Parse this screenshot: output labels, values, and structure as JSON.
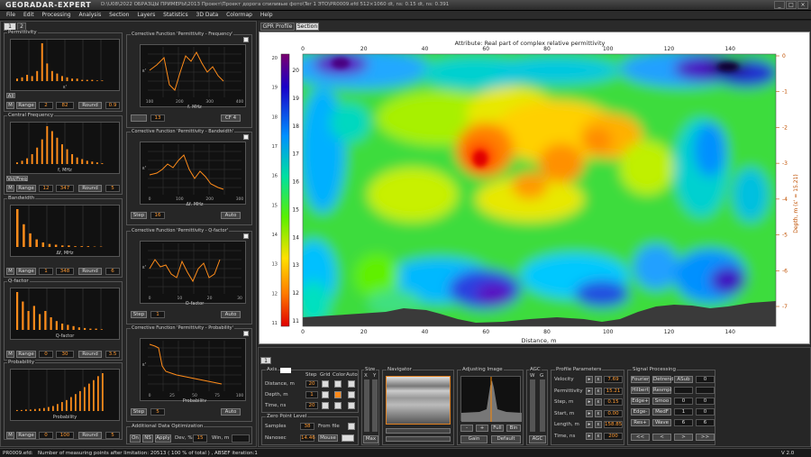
{
  "titlebar": {
    "logo": "GEORADAR-EXPERT",
    "info": "D:\\U08\\2022 ОБРАЗЦЫ ПРИМЕРЫ\\2013 Проект\\Проект дорога спиливые фото\\Ter 1 ЭТО\\PR0009.efd   512×1060   dt, ns: 0.15   dt, ns: 0.391"
  },
  "menu": [
    "File",
    "Edit",
    "Processing",
    "Analysis",
    "Section",
    "Layers",
    "Statistics",
    "3D Data",
    "Colormap",
    "Help"
  ],
  "left_tabs": [
    "1",
    "2"
  ],
  "histograms": [
    {
      "title": "Permittivity",
      "xlabel": "ε'",
      "mode": "M",
      "range_label": "Range",
      "v1": "2",
      "v2": "82",
      "round_label": "Round",
      "v3": "0.9",
      "all_label": "All"
    },
    {
      "title": "Central Frequency",
      "xlabel": "f, MHz",
      "mode": "M",
      "range_label": "Range",
      "v1": "12",
      "v2": "347",
      "round_label": "Round",
      "v3": "5",
      "extra": "Vol/Freq"
    },
    {
      "title": "Bandwidth",
      "xlabel": "Δf, MHz",
      "mode": "M",
      "range_label": "Range",
      "v1": "1",
      "v2": "348",
      "round_label": "Round",
      "v3": "6"
    },
    {
      "title": "Q-factor",
      "xlabel": "Q-factor",
      "mode": "M",
      "range_label": "Range",
      "v1": "0",
      "v2": "30",
      "round_label": "Round",
      "v3": "3.5"
    },
    {
      "title": "Probability",
      "xlabel": "Probability",
      "mode": "M",
      "range_label": "Range",
      "v1": "0",
      "v2": "100",
      "round_label": "Round",
      "v3": "5"
    }
  ],
  "corrective": [
    {
      "title": "Corrective Function 'Permittivity - Frequency'",
      "xlabel": "f, MHz",
      "ylabel": "ε'",
      "b1": "13",
      "b2": "CF 4",
      "xticks": [
        "100",
        "200",
        "300",
        "400"
      ]
    },
    {
      "title": "Corrective Function 'Permittivity - Bandwidth'",
      "xlabel": "Δf, MHz",
      "ylabel": "ε'",
      "b0": "Step",
      "b1": "16",
      "b2": "Auto",
      "xticks": [
        "0",
        "100",
        "200",
        "300"
      ]
    },
    {
      "title": "Corrective Function 'Permittivity - Q-factor'",
      "xlabel": "Q-factor",
      "ylabel": "ε'",
      "b0": "Step",
      "b1": "1",
      "b2": "Auto",
      "xticks": [
        "0",
        "10",
        "20",
        "30"
      ]
    },
    {
      "title": "Corrective Function 'Permittivity - Probability'",
      "xlabel": "Probability",
      "ylabel": "ε'",
      "b0": "Step",
      "b1": "5",
      "b2": "Auto",
      "xticks": [
        "0",
        "25",
        "50",
        "75",
        "100"
      ]
    }
  ],
  "additional": {
    "title": "Additional Data Optimization",
    "on": "On",
    "ns": "NS",
    "apply": "Apply",
    "dev_label": "Dev, %",
    "dev": "15",
    "win_label": "Win, m"
  },
  "main_tabs": [
    "GPR Profile",
    "Section"
  ],
  "chart_data": {
    "type": "heatmap",
    "title": "Attribute:  Real part of complex relative permittivity",
    "xlabel": "Distance, m",
    "ylabel": "Depth, m  (ε' = 15.21)",
    "x_ticks": [
      "0",
      "20",
      "40",
      "60",
      "80",
      "100",
      "120",
      "140"
    ],
    "y_ticks_left": [
      "20",
      "19",
      "18",
      "17",
      "16",
      "15",
      "14",
      "13",
      "12",
      "11"
    ],
    "y_ticks_right": [
      "0",
      "-1",
      "-2",
      "-3",
      "-4",
      "-5",
      "-6",
      "-7"
    ],
    "colorbar_ticks": [
      "20",
      "19",
      "18",
      "17",
      "16",
      "15",
      "14",
      "13",
      "12",
      "11"
    ],
    "xlim": [
      0,
      155
    ],
    "clim": [
      11,
      20
    ]
  },
  "bottom_tab": "1",
  "axis": {
    "title": "Axis",
    "step": "Step",
    "grid": "Grid",
    "color": "Color",
    "auto": "Auto",
    "rows": [
      {
        "label": "Distance, m",
        "v": "20"
      },
      {
        "label": "Depth, m",
        "v": "1"
      },
      {
        "label": "Time, ns",
        "v": "20"
      }
    ]
  },
  "zero": {
    "title": "Zero Point Level",
    "samples_label": "Samples",
    "samples": "38",
    "from_file": "From file",
    "nanosec_label": "Nanosec",
    "nanosec": "14.46",
    "mouse": "Mouse"
  },
  "size": {
    "title": "Size",
    "x": "X",
    "y": "Y",
    "max": "Max"
  },
  "navigator": {
    "title": "Navigator"
  },
  "adjusting": {
    "title": "Adjusting Image",
    "minus": "-",
    "plus": "+",
    "full": "Full",
    "bin": "Bin",
    "gain": "Gain",
    "default": "Default"
  },
  "agc": {
    "title": "AGC",
    "w": "W",
    "g": "G",
    "agc": "AGC"
  },
  "profile": {
    "title": "Profile Parameters",
    "rows": [
      {
        "label": "Velocity",
        "v": "7.69"
      },
      {
        "label": "Permittivity",
        "v": "15.21"
      },
      {
        "label": "Step, m",
        "v": "0.15"
      },
      {
        "label": "Start, m",
        "v": "0.00"
      },
      {
        "label": "Length, m",
        "v": "158.85"
      },
      {
        "label": "Time, ns",
        "v": "200"
      }
    ]
  },
  "signal": {
    "title": "Signal Processing",
    "rows": [
      [
        "Fourier",
        "Detrend",
        "ASub",
        "0"
      ],
      [
        "Hilbert",
        "Resmpl",
        "",
        ""
      ],
      [
        "Edge+",
        "Smoo",
        "0",
        "0"
      ],
      [
        "Edge-",
        "MedF",
        "1",
        "0"
      ],
      [
        "Res+",
        "Wave",
        "6",
        "6"
      ]
    ],
    "nav": [
      "<<",
      "<",
      ">",
      ">>"
    ]
  },
  "status": {
    "file": "PR0009.efd:",
    "msg": "Number of measuring points after limitation: 20513  ( 100 % of total )  ,  ABSEF iteration:1",
    "ver": "V 2.0"
  }
}
